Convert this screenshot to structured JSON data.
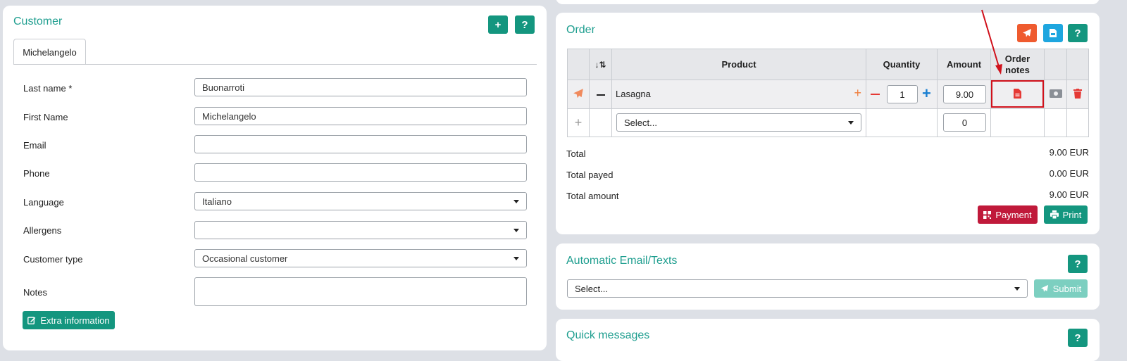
{
  "customer": {
    "title": "Customer",
    "add_label": "+",
    "help_label": "?",
    "tab_label": "Michelangelo",
    "fields": [
      {
        "label": "Last name *",
        "value": "Buonarroti"
      },
      {
        "label": "First Name",
        "value": "Michelangelo"
      },
      {
        "label": "Email",
        "value": ""
      },
      {
        "label": "Phone",
        "value": ""
      },
      {
        "label": "Language",
        "value": "Italiano"
      },
      {
        "label": "Allergens",
        "value": ""
      },
      {
        "label": "Customer type",
        "value": "Occasional customer"
      },
      {
        "label": "Notes",
        "value": ""
      }
    ],
    "extra_button": "Extra information"
  },
  "order": {
    "title": "Order",
    "help_label": "?",
    "columns": {
      "sort": "↓⇅",
      "product": "Product",
      "quantity": "Quantity",
      "amount": "Amount",
      "order_notes": "Order notes"
    },
    "rows": [
      {
        "product": "Lasagna",
        "quantity": "1",
        "amount": "9.00"
      }
    ],
    "new_row": {
      "product_placeholder": "Select...",
      "amount": "0"
    },
    "totals": [
      {
        "label": "Total",
        "value": "9.00 EUR"
      },
      {
        "label": "Total payed",
        "value": "0.00 EUR"
      },
      {
        "label": "Total amount",
        "value": "9.00 EUR"
      }
    ],
    "payment_button": "Payment",
    "print_button": "Print"
  },
  "auto_email": {
    "title": "Automatic Email/Texts",
    "help_label": "?",
    "select_placeholder": "Select...",
    "submit_button": "Submit"
  },
  "quick_messages": {
    "title": "Quick messages",
    "help_label": "?"
  },
  "colors": {
    "teal": "#14967f",
    "title_teal": "#1e9e8f",
    "orange": "#ef5b2f",
    "blue": "#1ea6df",
    "red": "#e53935",
    "payment_red": "#c0193a",
    "annotation_red": "#d0111b"
  }
}
